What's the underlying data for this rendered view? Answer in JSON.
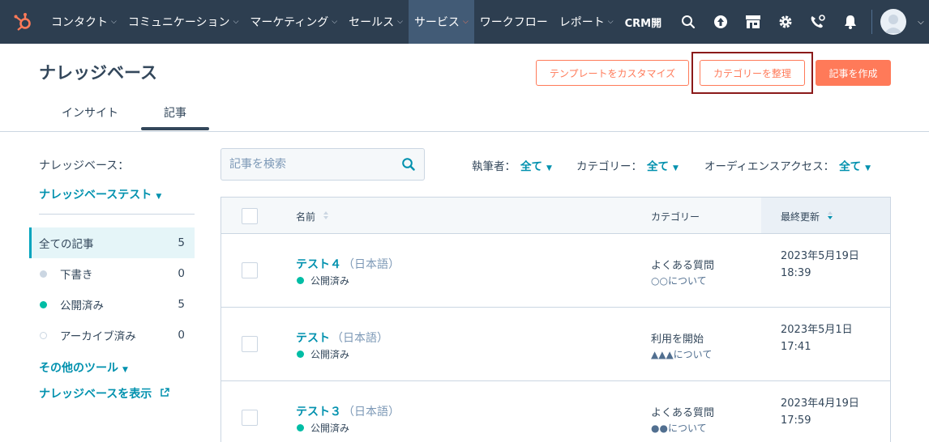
{
  "nav": {
    "items": [
      {
        "label": "コンタクト",
        "chevron": true
      },
      {
        "label": "コミュニケーション",
        "chevron": true
      },
      {
        "label": "マーケティング",
        "chevron": true
      },
      {
        "label": "セールス",
        "chevron": true
      },
      {
        "label": "サービス",
        "chevron": true,
        "active": true
      },
      {
        "label": "ワークフロー",
        "chevron": false
      },
      {
        "label": "レポート",
        "chevron": true
      },
      {
        "label": "CRM開",
        "chevron": false
      }
    ],
    "icons": [
      "search-icon",
      "upgrade-icon",
      "marketplace-icon",
      "settings-icon",
      "calling-icon",
      "notifications-icon"
    ]
  },
  "page": {
    "title": "ナレッジベース",
    "btn_template": "テンプレートをカスタマイズ",
    "btn_categories": "カテゴリーを整理",
    "btn_create": "記事を作成"
  },
  "tabs": [
    "インサイト",
    "記事"
  ],
  "sidebar": {
    "kb_label": "ナレッジベース：",
    "kb_selected": "ナレッジベーステスト",
    "filters": [
      {
        "label": "全ての記事",
        "count": "5"
      },
      {
        "label": "下書き",
        "count": "0"
      },
      {
        "label": "公開済み",
        "count": "5"
      },
      {
        "label": "アーカイブ済み",
        "count": "0"
      }
    ],
    "other_tools": "その他のツール",
    "view_kb": "ナレッジベースを表示"
  },
  "search": {
    "placeholder": "記事を検索"
  },
  "filters": {
    "author_label": "執筆者：",
    "author_value": "全て",
    "category_label": "カテゴリー：",
    "category_value": "全て",
    "audience_label": "オーディエンスアクセス：",
    "audience_value": "全て"
  },
  "table": {
    "headers": {
      "name": "名前",
      "category": "カテゴリー",
      "updated": "最終更新"
    },
    "rows": [
      {
        "title": "テスト４",
        "lang": "（日本語）",
        "status": "公開済み",
        "category": "よくある質問",
        "subcategory": "○○について",
        "date": "2023年5月19日",
        "time": "18:39"
      },
      {
        "title": "テスト",
        "lang": "（日本語）",
        "status": "公開済み",
        "category": "利用を開始",
        "subcategory": "▲▲▲について",
        "date": "2023年5月1日",
        "time": "17:41"
      },
      {
        "title": "テスト３",
        "lang": "（日本語）",
        "status": "公開済み",
        "category": "よくある質問",
        "subcategory": "●●について",
        "date": "2023年4月19日",
        "time": "17:59"
      }
    ]
  },
  "colors": {
    "nav_bg": "#2d3e50",
    "accent": "#ff7a59",
    "link": "#0091ae",
    "published": "#00bda5"
  }
}
